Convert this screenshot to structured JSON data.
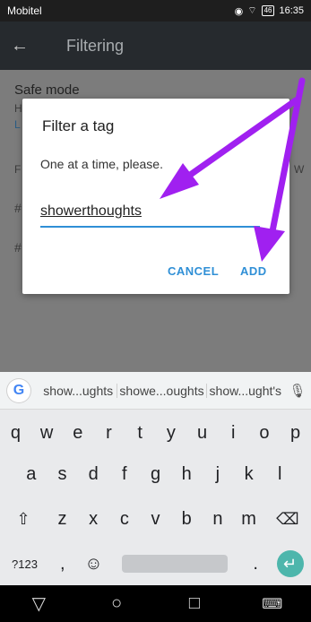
{
  "status_bar": {
    "carrier": "Mobitel",
    "battery": "46",
    "time": "16:35"
  },
  "app_bar": {
    "title": "Filtering"
  },
  "content": {
    "safe_mode_label": "Safe mode",
    "frag_h": "H",
    "frag_l": "L",
    "frag_f": "F",
    "frag_w": "W",
    "hash1": "#",
    "hash2": "#"
  },
  "dialog": {
    "title": "Filter a tag",
    "message": "One at a time, please.",
    "input_value": "showerthoughts",
    "cancel_label": "CANCEL",
    "add_label": "ADD"
  },
  "colors": {
    "accent": "#2f8fd6",
    "arrow": "#a020f0",
    "enter": "#4db6ac"
  },
  "keyboard": {
    "suggestions": [
      "show...ughts",
      "showe...oughts",
      "show...ught's"
    ],
    "row1": [
      "q",
      "w",
      "e",
      "r",
      "t",
      "y",
      "u",
      "i",
      "o",
      "p"
    ],
    "row1_hints": [
      "1",
      "2",
      "3",
      "4",
      "5",
      "6",
      "7",
      "8",
      "9",
      "0"
    ],
    "row2": [
      "a",
      "s",
      "d",
      "f",
      "g",
      "h",
      "j",
      "k",
      "l"
    ],
    "row3": [
      "z",
      "x",
      "c",
      "v",
      "b",
      "n",
      "m"
    ],
    "symbols_label": "?123",
    "comma": ",",
    "period": "."
  },
  "icons": [
    "back-arrow-icon",
    "google-icon",
    "mic-icon",
    "shift-icon",
    "backspace-icon",
    "emoji-icon",
    "enter-icon",
    "nav-back-icon",
    "nav-home-icon",
    "nav-recents-icon",
    "keyboard-icon"
  ]
}
